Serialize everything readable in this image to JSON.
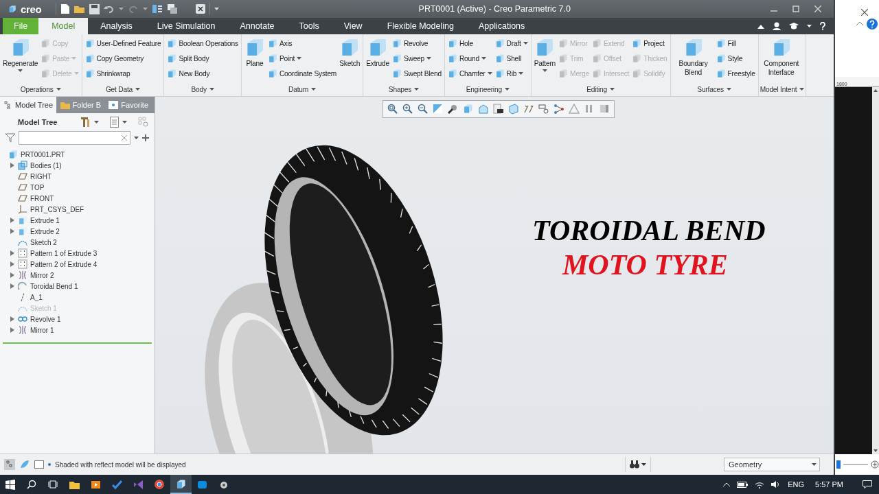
{
  "window": {
    "app_logo": "creo",
    "title": "PRT0001 (Active) - Creo Parametric 7.0"
  },
  "tabs": [
    {
      "label": "File",
      "kind": "file",
      "selected": false
    },
    {
      "label": "Model",
      "kind": "tab",
      "selected": true
    },
    {
      "label": "Analysis",
      "kind": "tab",
      "selected": false
    },
    {
      "label": "Live Simulation",
      "kind": "tab",
      "selected": false
    },
    {
      "label": "Annotate",
      "kind": "tab",
      "selected": false
    },
    {
      "label": "Tools",
      "kind": "tab",
      "selected": false
    },
    {
      "label": "View",
      "kind": "tab",
      "selected": false
    },
    {
      "label": "Flexible Modeling",
      "kind": "tab",
      "selected": false
    },
    {
      "label": "Applications",
      "kind": "tab",
      "selected": false
    }
  ],
  "ribbon": {
    "groups": [
      {
        "name": "Operations",
        "columns": [
          [
            {
              "label": "Regenerate",
              "kind": "large",
              "disabled": false,
              "menu": true
            }
          ],
          [
            {
              "label": "Copy",
              "kind": "small",
              "disabled": true,
              "menu": false
            },
            {
              "label": "Paste",
              "kind": "small",
              "disabled": true,
              "menu": true
            },
            {
              "label": "Delete",
              "kind": "small",
              "disabled": true,
              "menu": true
            }
          ]
        ]
      },
      {
        "name": "Get Data",
        "columns": [
          [
            {
              "label": "User-Defined Feature",
              "kind": "small",
              "disabled": false,
              "menu": false
            },
            {
              "label": "Copy Geometry",
              "kind": "small",
              "disabled": false,
              "menu": false
            },
            {
              "label": "Shrinkwrap",
              "kind": "small",
              "disabled": false,
              "menu": false
            }
          ]
        ]
      },
      {
        "name": "Body",
        "columns": [
          [
            {
              "label": "Boolean Operations",
              "kind": "small",
              "disabled": false,
              "menu": false
            },
            {
              "label": "Split Body",
              "kind": "small",
              "disabled": false,
              "menu": false
            },
            {
              "label": "New Body",
              "kind": "small",
              "disabled": false,
              "menu": false
            }
          ]
        ]
      },
      {
        "name": "Datum",
        "columns": [
          [
            {
              "label": "Plane",
              "kind": "large",
              "disabled": false,
              "menu": false
            }
          ],
          [
            {
              "label": "Axis",
              "kind": "small",
              "disabled": false,
              "menu": false
            },
            {
              "label": "Point",
              "kind": "small",
              "disabled": false,
              "menu": true
            },
            {
              "label": "Coordinate System",
              "kind": "small",
              "disabled": false,
              "menu": false
            }
          ],
          [
            {
              "label": "Sketch",
              "kind": "large",
              "disabled": false,
              "menu": false
            }
          ]
        ]
      },
      {
        "name": "Shapes",
        "columns": [
          [
            {
              "label": "Extrude",
              "kind": "large",
              "disabled": false,
              "menu": false
            }
          ],
          [
            {
              "label": "Revolve",
              "kind": "small",
              "disabled": false,
              "menu": false
            },
            {
              "label": "Sweep",
              "kind": "small",
              "disabled": false,
              "menu": true
            },
            {
              "label": "Swept Blend",
              "kind": "small",
              "disabled": false,
              "menu": false
            }
          ]
        ]
      },
      {
        "name": "Engineering",
        "columns": [
          [
            {
              "label": "Hole",
              "kind": "small",
              "disabled": false,
              "menu": false
            },
            {
              "label": "Round",
              "kind": "small",
              "disabled": false,
              "menu": true
            },
            {
              "label": "Chamfer",
              "kind": "small",
              "disabled": false,
              "menu": true
            }
          ],
          [
            {
              "label": "Draft",
              "kind": "small",
              "disabled": false,
              "menu": true
            },
            {
              "label": "Shell",
              "kind": "small",
              "disabled": false,
              "menu": false
            },
            {
              "label": "Rib",
              "kind": "small",
              "disabled": false,
              "menu": true
            }
          ]
        ]
      },
      {
        "name": "Editing",
        "columns": [
          [
            {
              "label": "Pattern",
              "kind": "large",
              "disabled": false,
              "menu": true
            }
          ],
          [
            {
              "label": "Mirror",
              "kind": "small",
              "disabled": true,
              "menu": false
            },
            {
              "label": "Trim",
              "kind": "small",
              "disabled": true,
              "menu": false
            },
            {
              "label": "Merge",
              "kind": "small",
              "disabled": true,
              "menu": false
            }
          ],
          [
            {
              "label": "Extend",
              "kind": "small",
              "disabled": true,
              "menu": false
            },
            {
              "label": "Offset",
              "kind": "small",
              "disabled": true,
              "menu": false
            },
            {
              "label": "Intersect",
              "kind": "small",
              "disabled": true,
              "menu": false
            }
          ],
          [
            {
              "label": "Project",
              "kind": "small",
              "disabled": false,
              "menu": false
            },
            {
              "label": "Thicken",
              "kind": "small",
              "disabled": true,
              "menu": false
            },
            {
              "label": "Solidify",
              "kind": "small",
              "disabled": true,
              "menu": false
            }
          ]
        ]
      },
      {
        "name": "Surfaces",
        "columns": [
          [
            {
              "label": "Boundary Blend",
              "kind": "large",
              "disabled": false,
              "menu": false
            }
          ],
          [
            {
              "label": "Fill",
              "kind": "small",
              "disabled": false,
              "menu": false
            },
            {
              "label": "Style",
              "kind": "small",
              "disabled": false,
              "menu": false
            },
            {
              "label": "Freestyle",
              "kind": "small",
              "disabled": false,
              "menu": false
            }
          ]
        ]
      },
      {
        "name": "Model Intent",
        "columns": [
          [
            {
              "label": "Component Interface",
              "kind": "large",
              "disabled": false,
              "menu": false
            }
          ]
        ]
      }
    ]
  },
  "panel": {
    "tabs": [
      {
        "label": "Model Tree",
        "selected": true
      },
      {
        "label": "Folder B",
        "selected": false
      },
      {
        "label": "Favorite",
        "selected": false
      }
    ],
    "header": "Model Tree",
    "tree": [
      {
        "label": "PRT0001.PRT",
        "kind": "part",
        "expandable": false,
        "disabled": false,
        "children": [
          {
            "label": "Bodies (1)",
            "kind": "body",
            "expandable": true,
            "disabled": false
          },
          {
            "label": "RIGHT",
            "kind": "plane",
            "expandable": false,
            "disabled": false
          },
          {
            "label": "TOP",
            "kind": "plane",
            "expandable": false,
            "disabled": false
          },
          {
            "label": "FRONT",
            "kind": "plane",
            "expandable": false,
            "disabled": false
          },
          {
            "label": "PRT_CSYS_DEF",
            "kind": "csys",
            "expandable": false,
            "disabled": false
          },
          {
            "label": "Extrude 1",
            "kind": "feature",
            "expandable": true,
            "disabled": false
          },
          {
            "label": "Extrude 2",
            "kind": "feature",
            "expandable": true,
            "disabled": false
          },
          {
            "label": "Sketch 2",
            "kind": "sketch",
            "expandable": false,
            "disabled": false
          },
          {
            "label": "Pattern 1 of Extrude 3",
            "kind": "pattern",
            "expandable": true,
            "disabled": false
          },
          {
            "label": "Pattern 2 of Extrude 4",
            "kind": "pattern",
            "expandable": true,
            "disabled": false
          },
          {
            "label": "Mirror 2",
            "kind": "mirror",
            "expandable": true,
            "disabled": false
          },
          {
            "label": "Toroidal Bend 1",
            "kind": "bend",
            "expandable": true,
            "disabled": false
          },
          {
            "label": "A_1",
            "kind": "axis",
            "expandable": false,
            "disabled": false
          },
          {
            "label": "Sketch 1",
            "kind": "sketch",
            "expandable": false,
            "disabled": true
          },
          {
            "label": "Revolve 1",
            "kind": "revolve",
            "expandable": true,
            "disabled": false
          },
          {
            "label": "Mirror 1",
            "kind": "mirror",
            "expandable": true,
            "disabled": false
          }
        ]
      }
    ]
  },
  "graphics": {
    "title_lines": [
      {
        "text": "TOROIDAL BEND",
        "color": "#000000"
      },
      {
        "text": "MOTO TYRE",
        "color": "#e0141e"
      }
    ]
  },
  "status_bar": {
    "message": "Shaded with reflect model will be displayed",
    "filter": "Geometry"
  },
  "background_window": {
    "ruler_label": "1800"
  },
  "taskbar": {
    "language": "ENG",
    "time": "5:57 PM"
  }
}
